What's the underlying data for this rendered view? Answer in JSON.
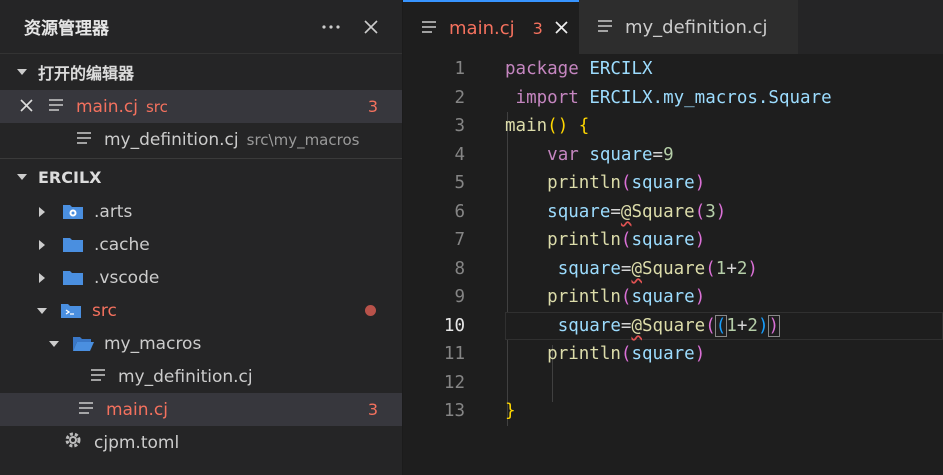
{
  "explorer": {
    "title": "资源管理器",
    "open_editors_label": "打开的编辑器",
    "open_editors": [
      {
        "name": "main.cj",
        "path": "src",
        "badge": "3"
      },
      {
        "name": "my_definition.cj",
        "path": "src\\my_macros"
      }
    ],
    "project_label": "ERCILX",
    "tree": {
      "arts": ".arts",
      "cache": ".cache",
      "vscode": ".vscode",
      "src": "src",
      "my_macros": "my_macros",
      "my_definition": "my_definition.cj",
      "main": "main.cj",
      "main_badge": "3",
      "cjpm": "cjpm.toml"
    }
  },
  "tabs": [
    {
      "label": "main.cj",
      "badge": "3"
    },
    {
      "label": "my_definition.cj"
    }
  ],
  "code": {
    "line_numbers": [
      "1",
      "2",
      "3",
      "4",
      "5",
      "6",
      "7",
      "8",
      "9",
      "10",
      "11",
      "12",
      "13"
    ],
    "current_line": "10"
  },
  "colors": {
    "accent": "#3794ff",
    "error": "#f4715e",
    "keyword": "#c586c0",
    "identifier": "#9cdcfe",
    "function": "#dcdcaa"
  }
}
